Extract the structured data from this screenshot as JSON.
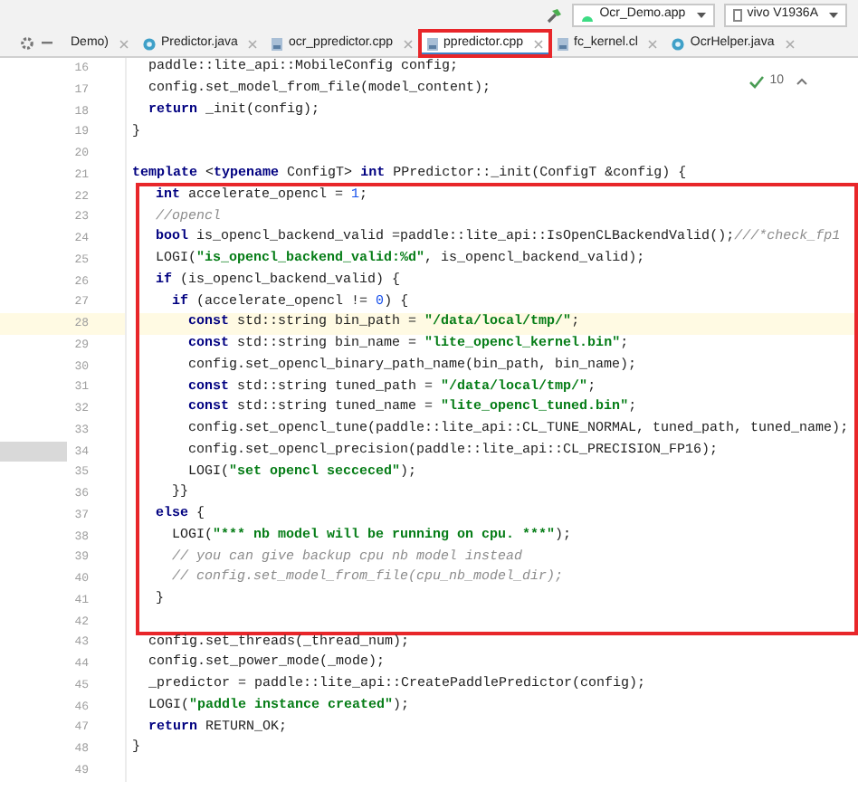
{
  "toolbar": {
    "run_config": "Ocr_Demo.app",
    "device": "vivo V1936A"
  },
  "tabs": [
    {
      "label": "Demo)",
      "kind": "cut",
      "selected": false,
      "annotated": false
    },
    {
      "label": "Predictor.java",
      "kind": "java",
      "selected": false,
      "annotated": false
    },
    {
      "label": "ocr_ppredictor.cpp",
      "kind": "cpp",
      "selected": false,
      "annotated": false
    },
    {
      "label": "ppredictor.cpp",
      "kind": "cpp",
      "selected": true,
      "annotated": true
    },
    {
      "label": "fc_kernel.cl",
      "kind": "cpp",
      "selected": false,
      "annotated": false
    },
    {
      "label": "OcrHelper.java",
      "kind": "java",
      "selected": false,
      "annotated": false
    }
  ],
  "inspections": {
    "count": "10"
  },
  "lines": [
    {
      "number": "16",
      "current": false,
      "marked": false,
      "segments": [
        {
          "kind": "plain",
          "text": "  paddle::lite_api::MobileConfig config;"
        }
      ]
    },
    {
      "number": "17",
      "current": false,
      "marked": false,
      "segments": [
        {
          "kind": "plain",
          "text": "  config.set_model_from_file(model_content);"
        }
      ]
    },
    {
      "number": "18",
      "current": false,
      "marked": false,
      "segments": [
        {
          "kind": "keyword",
          "text": "  return"
        },
        {
          "kind": "plain",
          "text": " _init(config);"
        }
      ]
    },
    {
      "number": "19",
      "current": false,
      "marked": false,
      "segments": [
        {
          "kind": "plain",
          "text": "}"
        }
      ]
    },
    {
      "number": "20",
      "current": false,
      "marked": false
    },
    {
      "number": "21",
      "current": false,
      "marked": false,
      "segments": [
        {
          "kind": "keyword",
          "text": "template"
        },
        {
          "kind": "plain",
          "text": " <"
        },
        {
          "kind": "keyword",
          "text": "typename"
        },
        {
          "kind": "plain",
          "text": " ConfigT> "
        },
        {
          "kind": "keyword",
          "text": "int"
        },
        {
          "kind": "plain",
          "text": " PPredictor::_init(ConfigT &config) {"
        }
      ]
    }
  ],
  "highlighted_lines": [
    {
      "number": "22",
      "current": false,
      "marked": false,
      "segments": [
        {
          "kind": "keyword",
          "text": "  int"
        },
        {
          "kind": "plain",
          "text": " accelerate_opencl = "
        },
        {
          "kind": "number",
          "text": "1"
        },
        {
          "kind": "plain",
          "text": ";"
        }
      ]
    },
    {
      "number": "23",
      "current": false,
      "marked": false,
      "segments": [
        {
          "kind": "comment",
          "text": "  //opencl"
        }
      ]
    },
    {
      "number": "24",
      "current": false,
      "marked": false,
      "segments": [
        {
          "kind": "keyword",
          "text": "  bool"
        },
        {
          "kind": "plain",
          "text": " is_opencl_backend_valid =paddle::lite_api::IsOpenCLBackendValid();"
        },
        {
          "kind": "comment",
          "text": "///*check_fp1"
        }
      ]
    },
    {
      "number": "25",
      "current": false,
      "marked": false,
      "segments": [
        {
          "kind": "plain",
          "text": "  LOGI("
        },
        {
          "kind": "string",
          "text": "\"is_opencl_backend_valid:%d\""
        },
        {
          "kind": "plain",
          "text": ", is_opencl_backend_valid);"
        }
      ]
    },
    {
      "number": "26",
      "current": false,
      "marked": false,
      "segments": [
        {
          "kind": "keyword",
          "text": "  if"
        },
        {
          "kind": "plain",
          "text": " (is_opencl_backend_valid) {"
        }
      ]
    },
    {
      "number": "27",
      "current": false,
      "marked": false,
      "segments": [
        {
          "kind": "keyword",
          "text": "    if"
        },
        {
          "kind": "plain",
          "text": " (accelerate_opencl != "
        },
        {
          "kind": "number",
          "text": "0"
        },
        {
          "kind": "plain",
          "text": ") {"
        }
      ]
    },
    {
      "number": "28",
      "current": true,
      "marked": false,
      "segments": [
        {
          "kind": "keyword",
          "text": "      const"
        },
        {
          "kind": "plain",
          "text": " std::string bin_path = "
        },
        {
          "kind": "string",
          "text": "\"/data/local/tmp/\""
        },
        {
          "kind": "plain",
          "text": ";"
        }
      ]
    },
    {
      "number": "29",
      "current": false,
      "marked": false,
      "segments": [
        {
          "kind": "keyword",
          "text": "      const"
        },
        {
          "kind": "plain",
          "text": " std::string bin_name = "
        },
        {
          "kind": "string",
          "text": "\"lite_opencl_kernel.bin\""
        },
        {
          "kind": "plain",
          "text": ";"
        }
      ]
    },
    {
      "number": "30",
      "current": false,
      "marked": false,
      "segments": [
        {
          "kind": "plain",
          "text": "      config.set_opencl_binary_path_name(bin_path, bin_name);"
        }
      ]
    },
    {
      "number": "31",
      "current": false,
      "marked": false,
      "segments": [
        {
          "kind": "keyword",
          "text": "      const"
        },
        {
          "kind": "plain",
          "text": " std::string tuned_path = "
        },
        {
          "kind": "string",
          "text": "\"/data/local/tmp/\""
        },
        {
          "kind": "plain",
          "text": ";"
        }
      ]
    },
    {
      "number": "32",
      "current": false,
      "marked": false,
      "segments": [
        {
          "kind": "keyword",
          "text": "      const"
        },
        {
          "kind": "plain",
          "text": " std::string tuned_name = "
        },
        {
          "kind": "string",
          "text": "\"lite_opencl_tuned.bin\""
        },
        {
          "kind": "plain",
          "text": ";"
        }
      ]
    },
    {
      "number": "33",
      "current": false,
      "marked": false,
      "segments": [
        {
          "kind": "plain",
          "text": "      config.set_opencl_tune(paddle::lite_api::CL_TUNE_NORMAL, tuned_path, tuned_name);"
        }
      ]
    },
    {
      "number": "34",
      "current": false,
      "marked": true,
      "segments": [
        {
          "kind": "plain",
          "text": "      config.set_opencl_precision(paddle::lite_api::CL_PRECISION_FP16);"
        }
      ]
    },
    {
      "number": "35",
      "current": false,
      "marked": false,
      "segments": [
        {
          "kind": "plain",
          "text": "      LOGI("
        },
        {
          "kind": "string",
          "text": "\"set opencl secceced\""
        },
        {
          "kind": "plain",
          "text": ");"
        }
      ]
    },
    {
      "number": "36",
      "current": false,
      "marked": false,
      "segments": [
        {
          "kind": "plain",
          "text": "    }}"
        }
      ]
    },
    {
      "number": "37",
      "current": false,
      "marked": false,
      "segments": [
        {
          "kind": "keyword",
          "text": "  else"
        },
        {
          "kind": "plain",
          "text": " {"
        }
      ]
    },
    {
      "number": "38",
      "current": false,
      "marked": false,
      "segments": [
        {
          "kind": "plain",
          "text": "    LOGI("
        },
        {
          "kind": "string",
          "text": "\"*** nb model will be running on cpu. ***\""
        },
        {
          "kind": "plain",
          "text": ");"
        }
      ]
    },
    {
      "number": "39",
      "current": false,
      "marked": false,
      "segments": [
        {
          "kind": "comment",
          "text": "    // you can give backup cpu nb model instead"
        }
      ]
    },
    {
      "number": "40",
      "current": false,
      "marked": false,
      "segments": [
        {
          "kind": "comment",
          "text": "    // config.set_model_from_file(cpu_nb_model_dir);"
        }
      ]
    },
    {
      "number": "41",
      "current": false,
      "marked": false,
      "segments": [
        {
          "kind": "plain",
          "text": "  }"
        }
      ]
    },
    {
      "number": "42",
      "current": false,
      "marked": false
    }
  ],
  "lines_after": [
    {
      "number": "43",
      "current": false,
      "marked": false,
      "segments": [
        {
          "kind": "plain",
          "text": "  config.set_threads(_thread_num);"
        }
      ]
    },
    {
      "number": "44",
      "current": false,
      "marked": false,
      "segments": [
        {
          "kind": "plain",
          "text": "  config.set_power_mode(_mode);"
        }
      ]
    },
    {
      "number": "45",
      "current": false,
      "marked": false,
      "segments": [
        {
          "kind": "plain",
          "text": "  _predictor = paddle::lite_api::CreatePaddlePredictor(config);"
        }
      ]
    },
    {
      "number": "46",
      "current": false,
      "marked": false,
      "segments": [
        {
          "kind": "plain",
          "text": "  LOGI("
        },
        {
          "kind": "string",
          "text": "\"paddle instance created\""
        },
        {
          "kind": "plain",
          "text": ");"
        }
      ]
    },
    {
      "number": "47",
      "current": false,
      "marked": false,
      "segments": [
        {
          "kind": "keyword",
          "text": "  return"
        },
        {
          "kind": "plain",
          "text": " RETURN_OK;"
        }
      ]
    },
    {
      "number": "48",
      "current": false,
      "marked": false,
      "segments": [
        {
          "kind": "plain",
          "text": "}"
        }
      ]
    },
    {
      "number": "49",
      "current": false,
      "marked": false
    }
  ]
}
